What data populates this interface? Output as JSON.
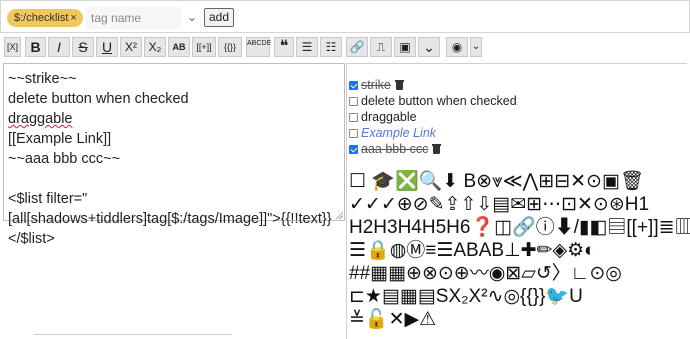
{
  "tag_bar": {
    "tag_pill": "$:/checklist",
    "tag_remove": "×",
    "tag_input_placeholder": "tag name",
    "dropdown_icon": "chevron-down-icon",
    "add_label": "add"
  },
  "toolbar": {
    "buttons": [
      {
        "name": "excise-button",
        "label": "[X]"
      },
      {
        "name": "bold-button",
        "label": "B"
      },
      {
        "name": "italic-button",
        "label": "I"
      },
      {
        "name": "strikethrough-button",
        "label": "S"
      },
      {
        "name": "underline-button",
        "label": "U"
      },
      {
        "name": "superscript-button",
        "label": "X²"
      },
      {
        "name": "subscript-button",
        "label": "X₂"
      },
      {
        "name": "smallcaps-button",
        "label": "AB"
      },
      {
        "name": "transclude-button",
        "label": "[[+]]"
      },
      {
        "name": "macro-button",
        "label": "{{}}"
      },
      {
        "name": "mono-block-button",
        "label": "ABCDE"
      },
      {
        "name": "quote-button",
        "label": "❝"
      },
      {
        "name": "bullet-list-button",
        "label": "☰"
      },
      {
        "name": "number-list-button",
        "label": "☷"
      },
      {
        "name": "link-button",
        "label": "🔗"
      },
      {
        "name": "stamp-button",
        "label": "⎍"
      },
      {
        "name": "picture-button",
        "label": "▣"
      },
      {
        "name": "more-dropdown-button",
        "label": "⌄"
      },
      {
        "name": "preview-toggle-button",
        "label": "◉"
      },
      {
        "name": "preview-type-button",
        "label": "⌄"
      }
    ]
  },
  "editor": {
    "lines": [
      "~~strike~~",
      "delete button when checked",
      "draggable",
      "[[Example Link]]",
      "~~aaa bbb ccc~~",
      "",
      "<$list filter=\"[all[shadows+tiddlers]tag[$:/tags/Image]]\">{{!!text}}</$list>"
    ]
  },
  "preview": {
    "items": [
      {
        "label": "strike",
        "checked": true,
        "style": "strike",
        "trash": true
      },
      {
        "label": "delete button when checked",
        "checked": false,
        "style": "plain",
        "trash": false
      },
      {
        "label": "draggable",
        "checked": false,
        "style": "plain",
        "trash": false
      },
      {
        "label": "Example Link",
        "checked": false,
        "style": "link",
        "trash": false
      },
      {
        "label": "aaa bbb ccc",
        "checked": true,
        "style": "strike",
        "trash": true
      }
    ],
    "icon_rows": [
      "☐ 🎓❎🔍⬇         B⊗⩔≪⋀⊞⊟✕⊙▣🗑",
      "✓✓✓⊕⊘✎⇪⇧⇩▤✉⊞⋯⊡✕⊙⊛H1",
      "H2H3H4H5H6❓◫🔗ⓘ⬇/▮◧▤[[+]]≣▥",
      "☰🔒◍Ⓜ≡☰ABAB⊥✚✏◈⚙◐",
      "##▦▦⊕⊗⊙⊕〰◉⊠▱↺〉∟⊙◎",
      "⊏★▤▦▤SX₂X²∿◎{{}}🐦U",
      "≚🔓✕▶⚠"
    ]
  },
  "colors": {
    "tag_pill": "#f0c75e",
    "link": "#5778d8",
    "check": "#1a73e8"
  }
}
